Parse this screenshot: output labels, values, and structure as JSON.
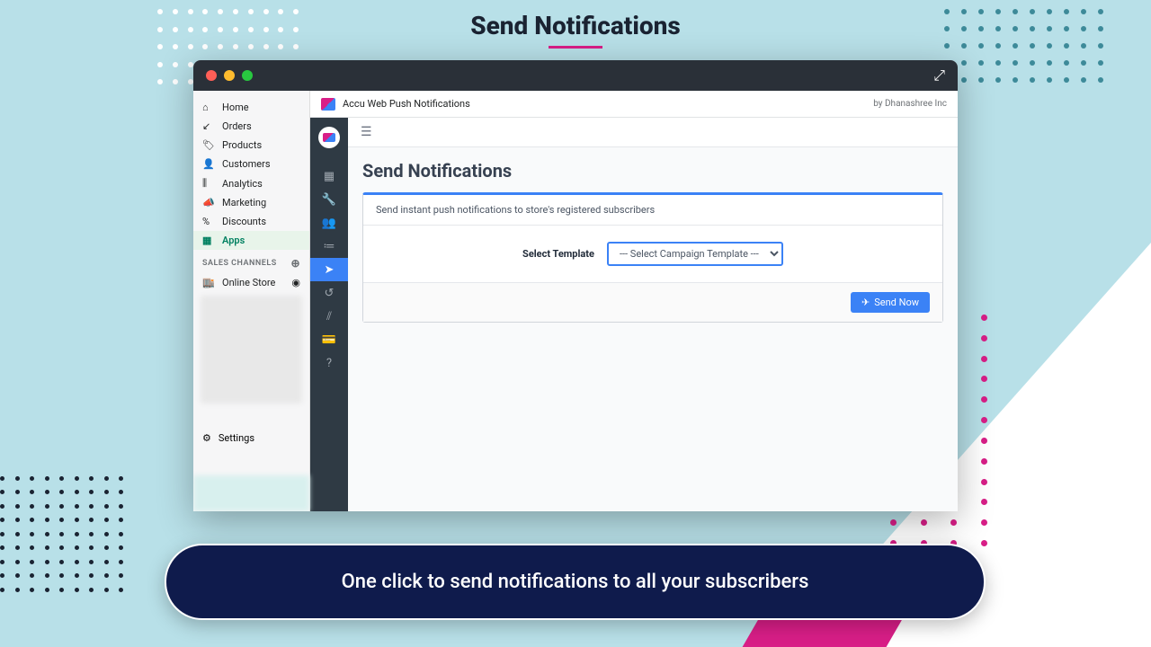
{
  "hero_title": "Send Notifications",
  "shopify_nav": {
    "items": [
      {
        "icon": "⌂",
        "label": "Home"
      },
      {
        "icon": "↙",
        "label": "Orders"
      },
      {
        "icon": "🏷",
        "label": "Products"
      },
      {
        "icon": "👤",
        "label": "Customers"
      },
      {
        "icon": "⫼",
        "label": "Analytics"
      },
      {
        "icon": "📣",
        "label": "Marketing"
      },
      {
        "icon": "%",
        "label": "Discounts"
      },
      {
        "icon": "▦",
        "label": "Apps"
      }
    ],
    "sales_channels_label": "SALES CHANNELS",
    "online_store": "Online Store",
    "settings": "Settings"
  },
  "app_header": {
    "title": "Accu Web Push Notifications",
    "vendor": "by Dhanashree Inc"
  },
  "icon_sidebar": {
    "icons": [
      "▦",
      "🔧",
      "👥",
      "≔",
      "➤",
      "↺",
      "⫽",
      "💳",
      "?"
    ]
  },
  "page": {
    "title": "Send Notifications",
    "description": "Send instant push notifications to store's registered subscribers",
    "template_label": "Select Template",
    "template_placeholder": "--- Select Campaign Template ---",
    "send_button": "Send Now"
  },
  "banner": "One click to send notifications to all your subscribers"
}
